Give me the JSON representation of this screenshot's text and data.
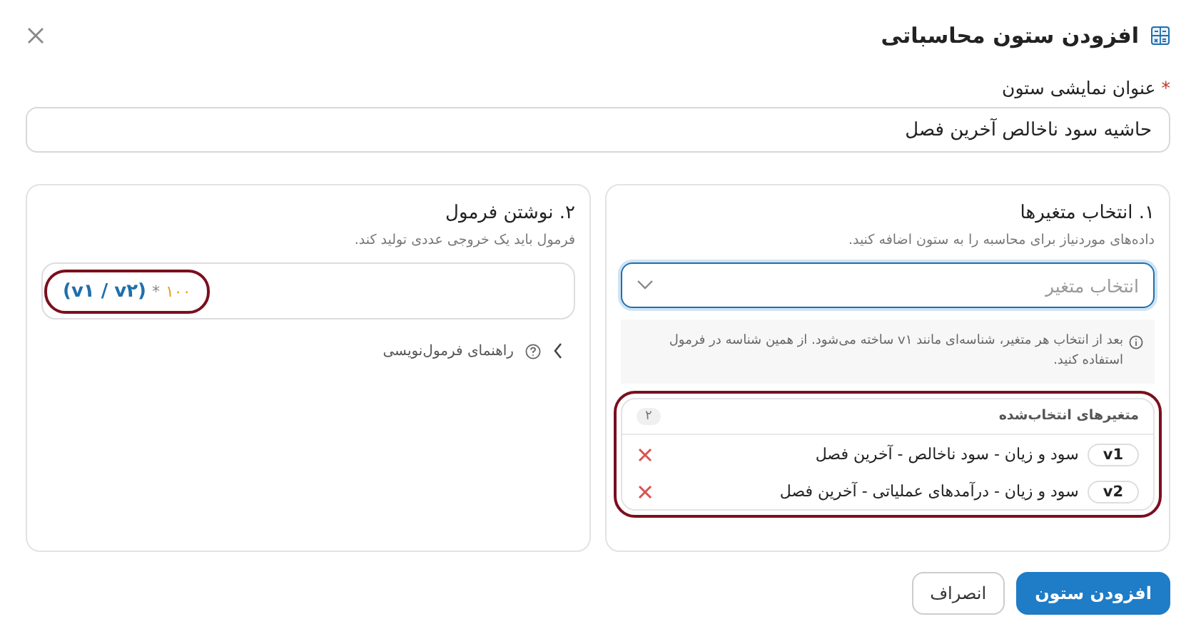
{
  "dialog": {
    "title": "افزودن ستون محاسباتی"
  },
  "column_title": {
    "label": "عنوان نمایشی ستون",
    "required": true,
    "value": "حاشیه سود ناخالص آخرین فصل"
  },
  "variables_panel": {
    "heading": "۱. انتخاب متغیرها",
    "description": "داده‌های موردنیاز برای محاسبه را به ستون اضافه کنید.",
    "select": {
      "placeholder": "انتخاب متغیر",
      "focused": true
    },
    "info": "بعد از انتخاب هر متغیر، شناسه‌ای مانند v۱ ساخته می‌شود. از همین شناسه در فرمول استفاده کنید.",
    "selected": {
      "title": "متغیرهای انتخاب‌شده",
      "count": "۲",
      "highlighted": true,
      "items": [
        {
          "id": "v1",
          "name": "سود و زیان - سود ناخالص - آخرین فصل"
        },
        {
          "id": "v2",
          "name": "سود و زیان - درآمدهای عملیاتی - آخرین فصل"
        }
      ]
    }
  },
  "formula_panel": {
    "heading": "۲. نوشتن فرمول",
    "description": "فرمول باید یک خروجی عددی تولید کند.",
    "highlighted": true,
    "tokens": [
      {
        "kind": "variable",
        "text": "(v۱ / v۲)"
      },
      {
        "kind": "operator",
        "text": "*"
      },
      {
        "kind": "number",
        "text": "۱۰۰"
      }
    ],
    "help": {
      "label": "راهنمای فرمول‌نویسی",
      "expanded": false
    }
  },
  "buttons": [
    {
      "label": "افزودن ستون",
      "kind": "primary"
    },
    {
      "label": "انصراف",
      "kind": "secondary"
    }
  ]
}
